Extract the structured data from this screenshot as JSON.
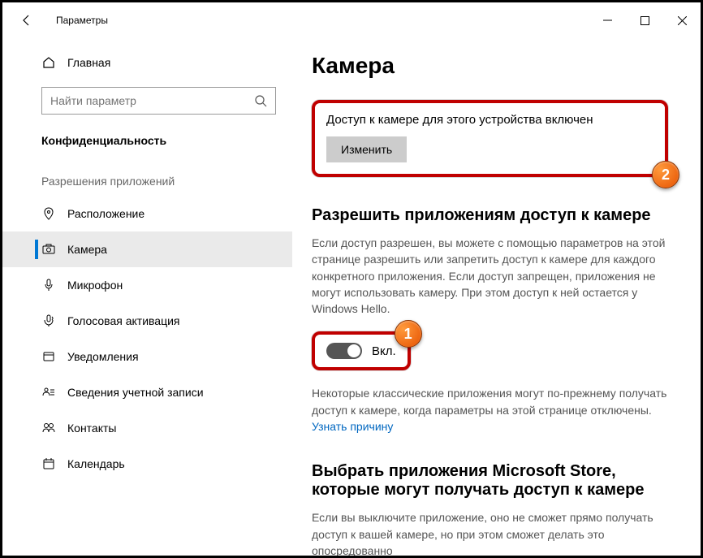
{
  "window": {
    "title": "Параметры"
  },
  "sidebar": {
    "home": "Главная",
    "search_placeholder": "Найти параметр",
    "category": "Конфиденциальность",
    "group_title": "Разрешения приложений",
    "items": [
      {
        "icon": "location",
        "label": "Расположение"
      },
      {
        "icon": "camera",
        "label": "Камера"
      },
      {
        "icon": "microphone",
        "label": "Микрофон"
      },
      {
        "icon": "voice",
        "label": "Голосовая активация"
      },
      {
        "icon": "notifications",
        "label": "Уведомления"
      },
      {
        "icon": "account",
        "label": "Сведения учетной записи"
      },
      {
        "icon": "contacts",
        "label": "Контакты"
      },
      {
        "icon": "calendar",
        "label": "Календарь"
      }
    ]
  },
  "content": {
    "heading": "Камера",
    "device_access": {
      "status": "Доступ к камере для этого устройства включен",
      "button": "Изменить"
    },
    "app_access": {
      "title": "Разрешить приложениям доступ к камере",
      "desc": "Если доступ разрешен, вы можете с помощью параметров на этой странице разрешить или запретить доступ к камере для каждого конкретного приложения. Если доступ запрещен, приложения не могут использовать камеру. При этом доступ к ней остается у Windows Hello.",
      "toggle_label": "Вкл.",
      "note_prefix": "Некоторые классические приложения могут по-прежнему получать доступ к камере, когда параметры на этой странице отключены. ",
      "note_link": "Узнать причину"
    },
    "store_apps": {
      "title": "Выбрать приложения Microsoft Store, которые могут получать доступ к камере",
      "desc": "Если вы выключите приложение, оно не сможет прямо получать доступ к вашей камере, но при этом сможет делать это опосредованно"
    }
  },
  "annotations": {
    "badge1": "1",
    "badge2": "2"
  }
}
